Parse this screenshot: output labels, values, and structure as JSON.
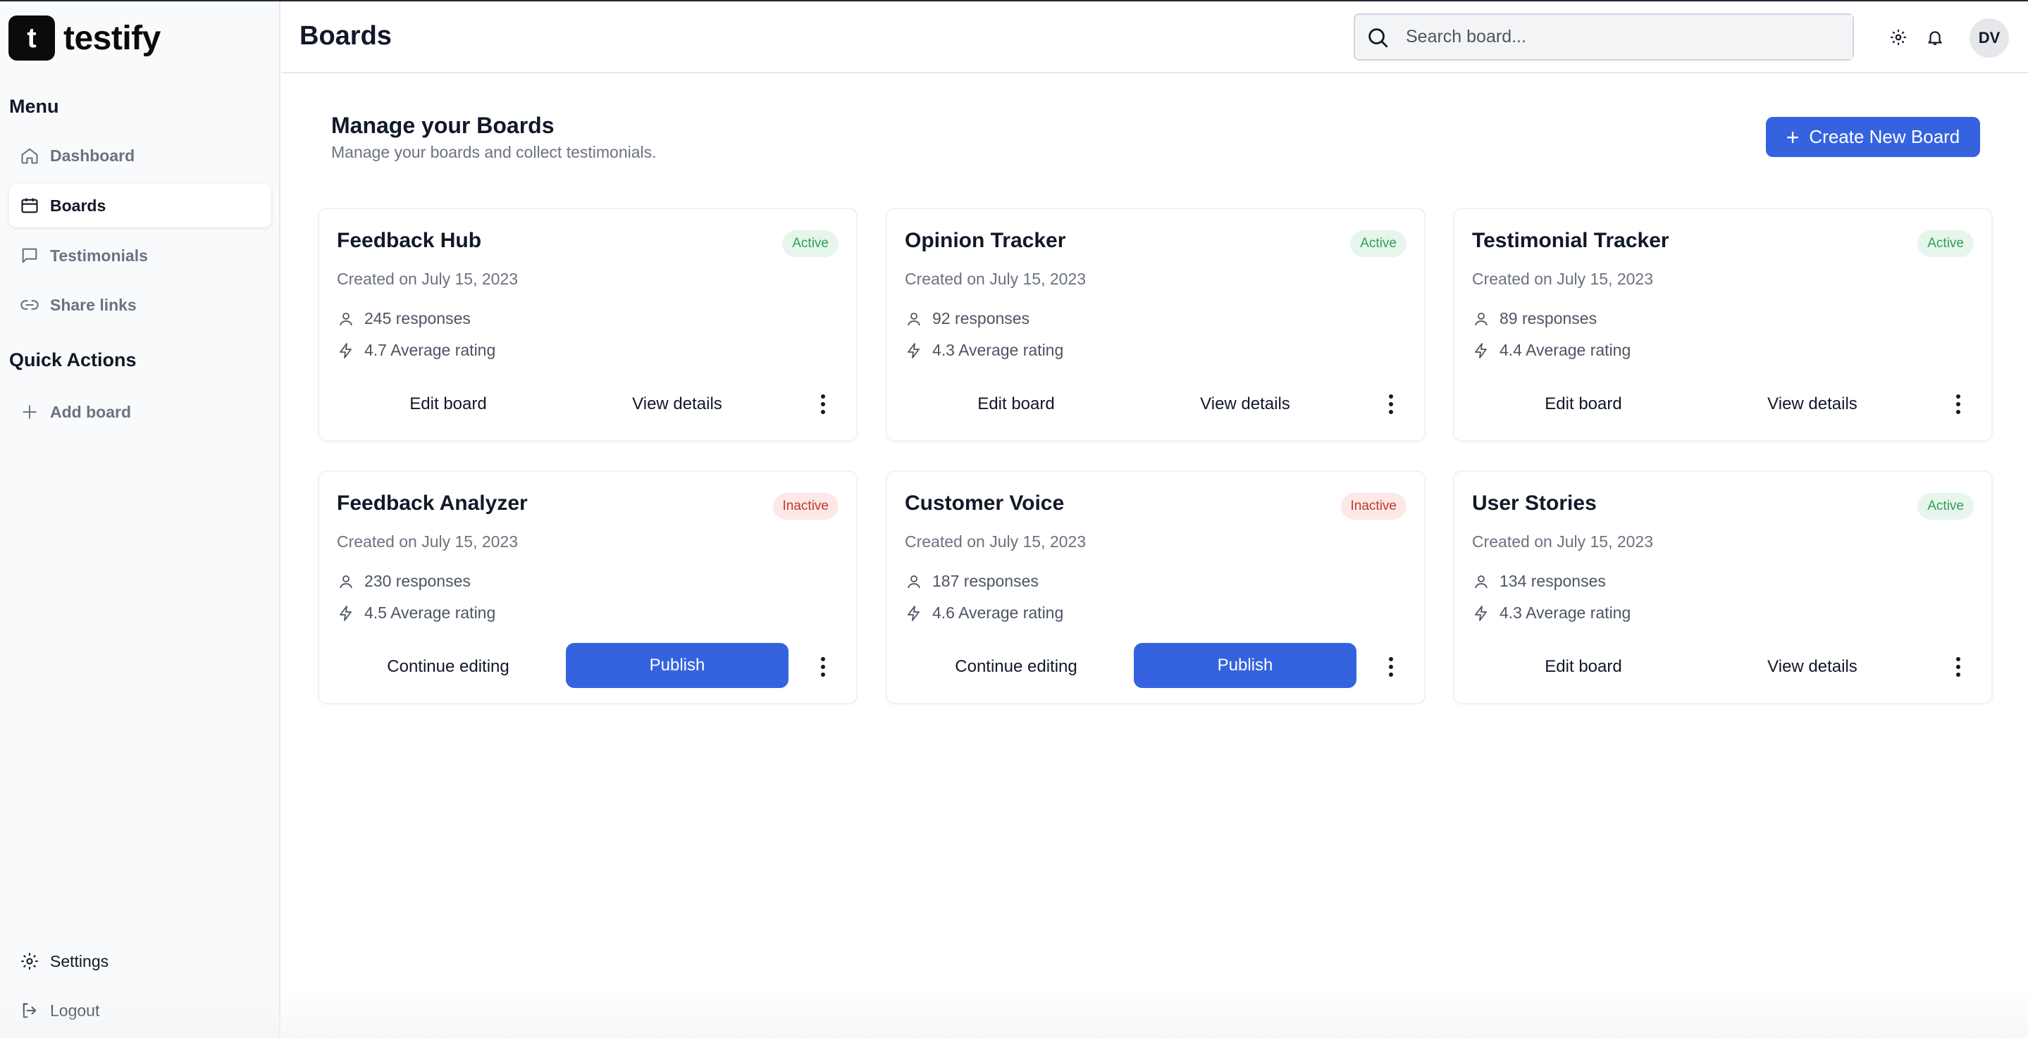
{
  "brand": {
    "logo_letter": "t",
    "name": "testify"
  },
  "sidebar": {
    "menu_title": "Menu",
    "menu_items": [
      {
        "label": "Dashboard",
        "icon": "home-icon"
      },
      {
        "label": "Boards",
        "icon": "board-icon",
        "active": true
      },
      {
        "label": "Testimonials",
        "icon": "message-icon"
      },
      {
        "label": "Share links",
        "icon": "link-icon"
      }
    ],
    "quick_title": "Quick Actions",
    "quick_items": [
      {
        "label": "Add board",
        "icon": "plus-icon"
      }
    ],
    "bottom_items": [
      {
        "label": "Settings",
        "icon": "gear-icon"
      },
      {
        "label": "Logout",
        "icon": "logout-icon"
      }
    ]
  },
  "header": {
    "title": "Boards",
    "search_placeholder": "Search board...",
    "avatar_initials": "DV"
  },
  "main": {
    "title": "Manage your Boards",
    "subtitle": "Manage your boards and collect testimonials.",
    "create_button": "Create New Board"
  },
  "boards": [
    {
      "name": "Feedback Hub",
      "status": "Active",
      "created": "Created on July 15, 2023",
      "responses": "245 responses",
      "rating": "4.7 Average rating",
      "primary": "Edit board",
      "secondary": "View details"
    },
    {
      "name": "Opinion Tracker",
      "status": "Active",
      "created": "Created on July 15, 2023",
      "responses": "92 responses",
      "rating": "4.3 Average rating",
      "primary": "Edit board",
      "secondary": "View details"
    },
    {
      "name": "Testimonial Tracker",
      "status": "Active",
      "created": "Created on July 15, 2023",
      "responses": "89 responses",
      "rating": "4.4 Average rating",
      "primary": "Edit board",
      "secondary": "View details"
    },
    {
      "name": "Feedback Analyzer",
      "status": "Inactive",
      "created": "Created on July 15, 2023",
      "responses": "230 responses",
      "rating": "4.5 Average rating",
      "primary": "Continue editing",
      "secondary": "Publish"
    },
    {
      "name": "Customer Voice",
      "status": "Inactive",
      "created": "Created on July 15, 2023",
      "responses": "187 responses",
      "rating": "4.6 Average rating",
      "primary": "Continue editing",
      "secondary": "Publish"
    },
    {
      "name": "User Stories",
      "status": "Active",
      "created": "Created on July 15, 2023",
      "responses": "134 responses",
      "rating": "4.3 Average rating",
      "primary": "Edit board",
      "secondary": "View details"
    }
  ],
  "colors": {
    "accent": "#3563e0",
    "active_badge_bg": "#e7f6ec",
    "active_badge_text": "#2f9e55",
    "inactive_badge_bg": "#fde8e8",
    "inactive_badge_text": "#c0392b"
  }
}
